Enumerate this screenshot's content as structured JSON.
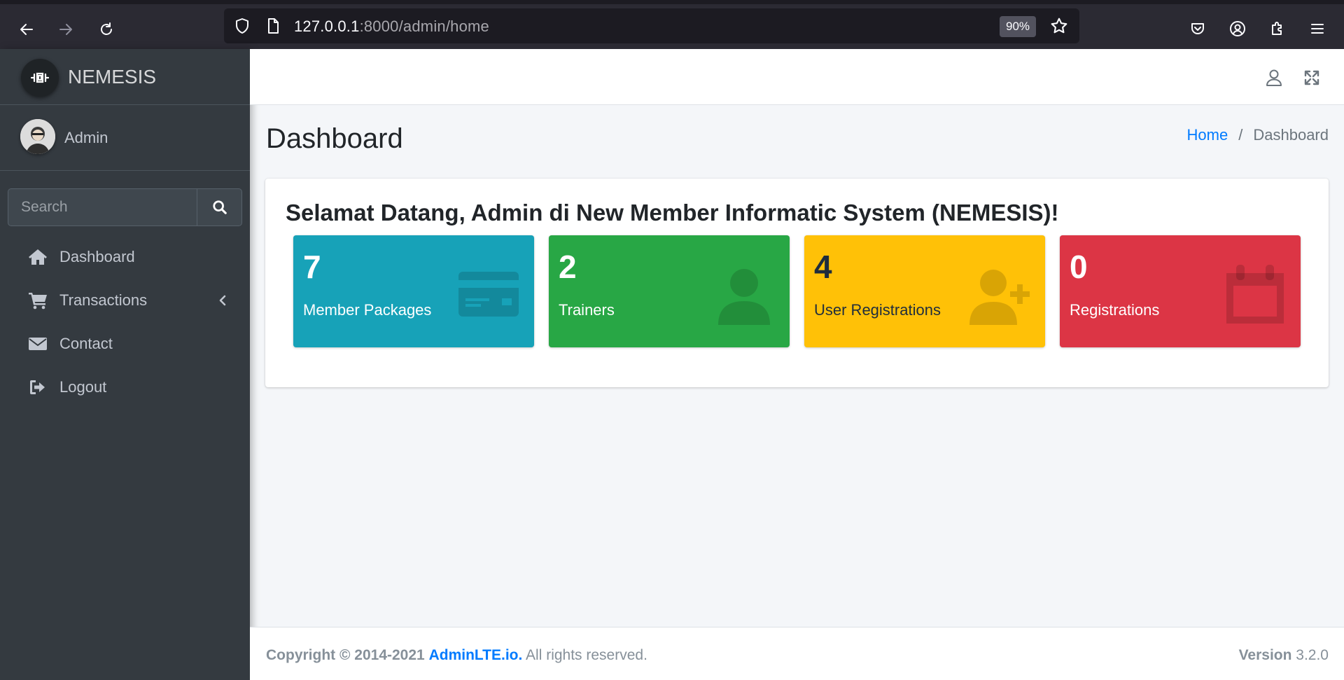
{
  "browser": {
    "url_host": "127.0.0.1",
    "url_rest": ":8000/admin/home",
    "zoom": "90%"
  },
  "sidebar": {
    "brand": "NEMESIS",
    "user_name": "Admin",
    "search_placeholder": "Search",
    "items": [
      {
        "label": "Dashboard",
        "icon": "home-icon"
      },
      {
        "label": "Transactions",
        "icon": "cart-icon"
      },
      {
        "label": "Contact",
        "icon": "envelope-icon"
      },
      {
        "label": "Logout",
        "icon": "sign-out-icon"
      }
    ]
  },
  "header": {
    "title": "Dashboard",
    "breadcrumb": [
      "Home",
      "Dashboard"
    ]
  },
  "main": {
    "welcome": "Selamat Datang, Admin di New Member Informatic System (NEMESIS)!",
    "boxes": [
      {
        "value": "7",
        "label": "Member Packages",
        "color": "#17a2b8",
        "icon": "credit-card-icon"
      },
      {
        "value": "2",
        "label": "Trainers",
        "color": "#28a745",
        "icon": "user-icon"
      },
      {
        "value": "4",
        "label": "User Registrations",
        "color": "#ffc107",
        "icon": "user-plus-icon"
      },
      {
        "value": "0",
        "label": "Registrations",
        "color": "#dc3545",
        "icon": "calendar-icon"
      }
    ]
  },
  "footer": {
    "copyright_prefix": "Copyright © 2014-2021",
    "brand_link": "AdminLTE.io.",
    "rights": "All rights reserved.",
    "version_label": "Version",
    "version": "3.2.0"
  }
}
